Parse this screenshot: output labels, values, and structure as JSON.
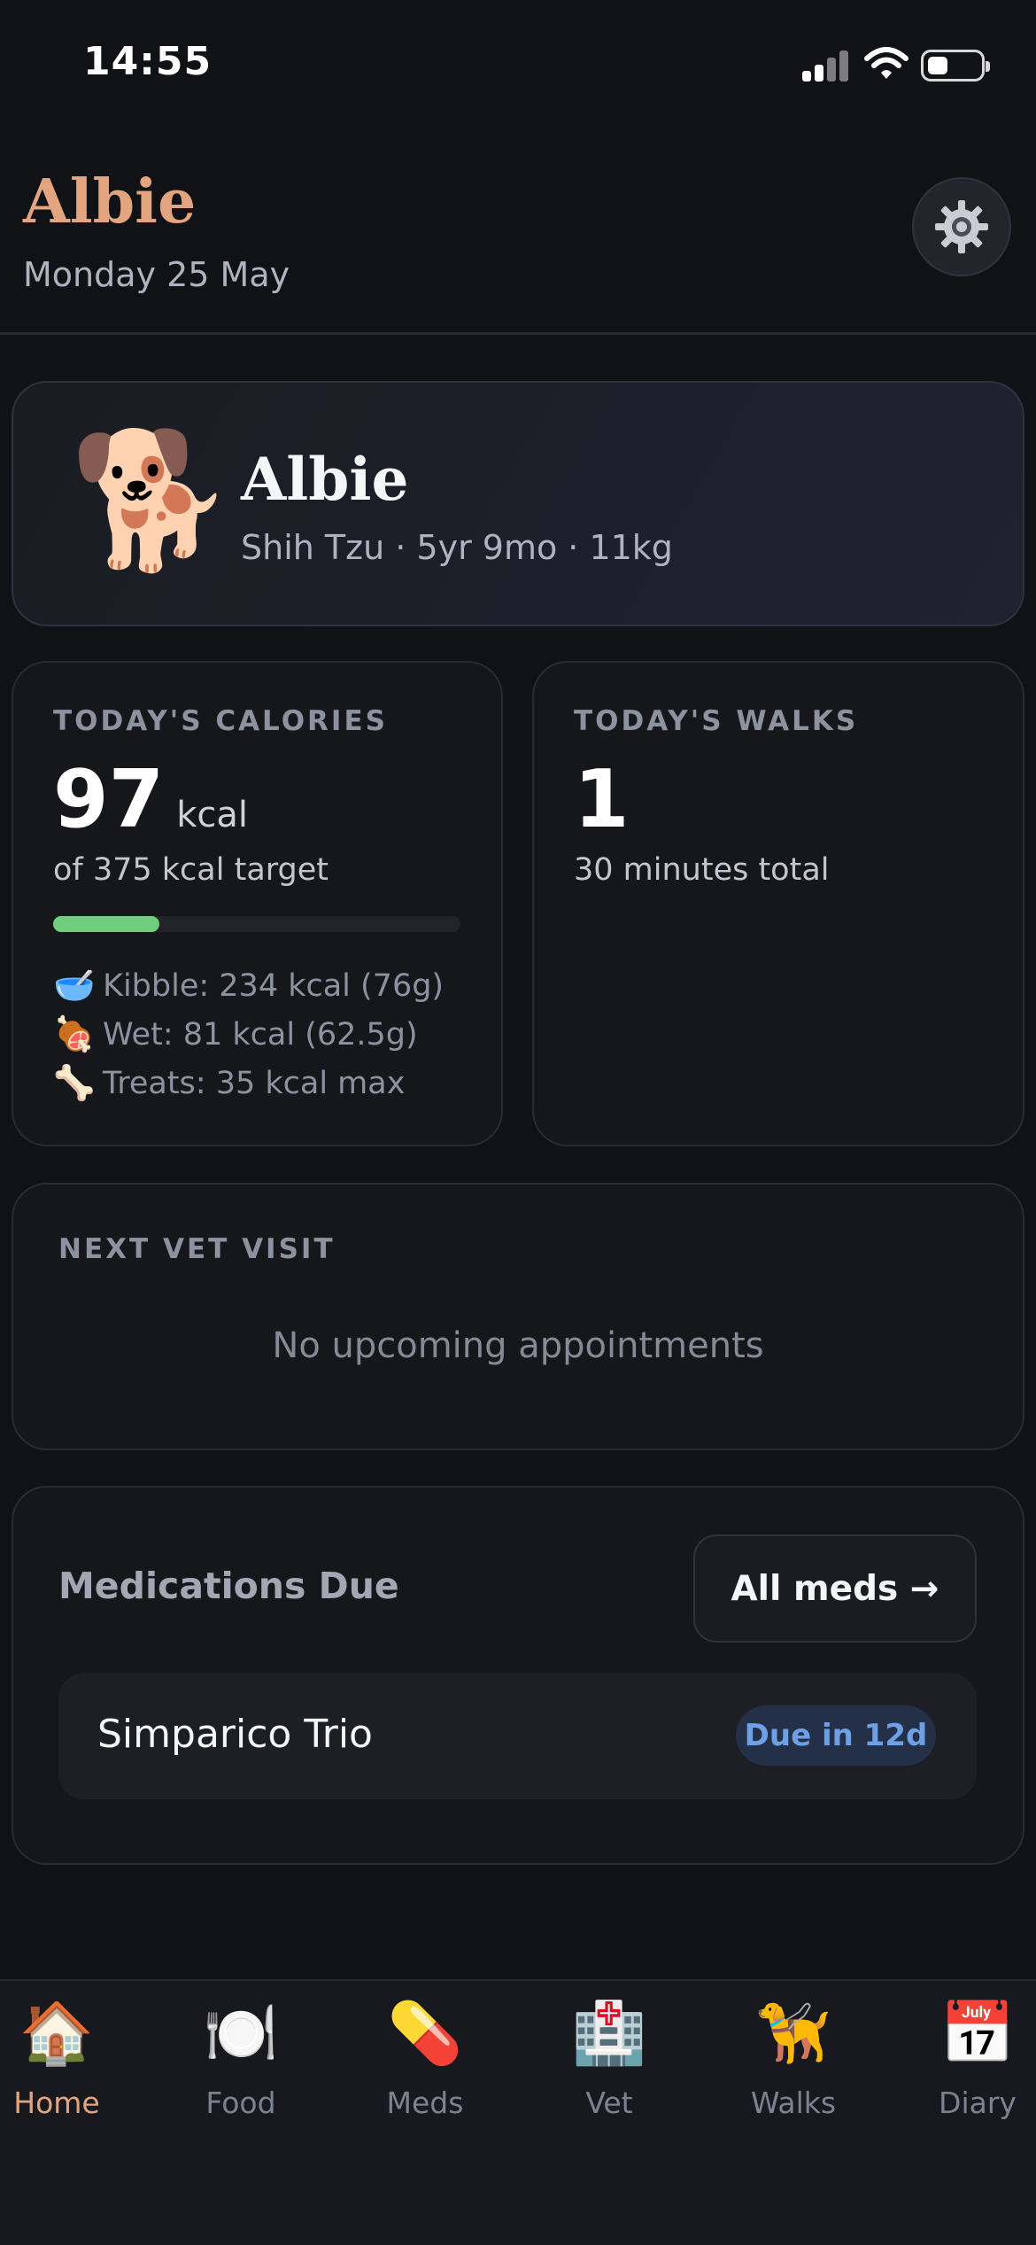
{
  "status_bar": {
    "time": "14:55"
  },
  "header": {
    "title": "Albie",
    "date": "Monday 25 May",
    "settings_icon": "gear-icon"
  },
  "pet": {
    "emoji": "🐕",
    "name": "Albie",
    "meta": "Shih Tzu · 5yr 9mo · 11kg"
  },
  "calories": {
    "label": "TODAY'S CALORIES",
    "value": "97",
    "unit": "kcal",
    "target": "of 375 kcal target",
    "progress_fraction": 0.26,
    "progress_color": "#6fcf7f",
    "items": [
      {
        "icon": "🥣",
        "text": "Kibble: 234 kcal (76g)"
      },
      {
        "icon": "🍖",
        "text": "Wet: 81 kcal (62.5g)"
      },
      {
        "icon": "🦴",
        "text": "Treats: 35 kcal max"
      }
    ]
  },
  "walks": {
    "label": "TODAY'S WALKS",
    "value": "1",
    "total": "30 minutes total"
  },
  "vet": {
    "label": "NEXT VET VISIT",
    "empty": "No upcoming appointments"
  },
  "meds": {
    "title": "Medications Due",
    "all_button": "All meds →",
    "items": [
      {
        "name": "Simparico Trio",
        "badge": "Due in 12d"
      }
    ]
  },
  "tabs": [
    {
      "icon": "🏠",
      "label": "Home",
      "active": true
    },
    {
      "icon": "🍽️",
      "label": "Food"
    },
    {
      "icon": "💊",
      "label": "Meds"
    },
    {
      "icon": "🏥",
      "label": "Vet"
    },
    {
      "icon": "🦮",
      "label": "Walks"
    },
    {
      "icon": "📅",
      "label": "Diary"
    }
  ],
  "colors": {
    "accent": "#e3a57f",
    "background": "#111216",
    "badge_text": "#6ea0e6"
  }
}
